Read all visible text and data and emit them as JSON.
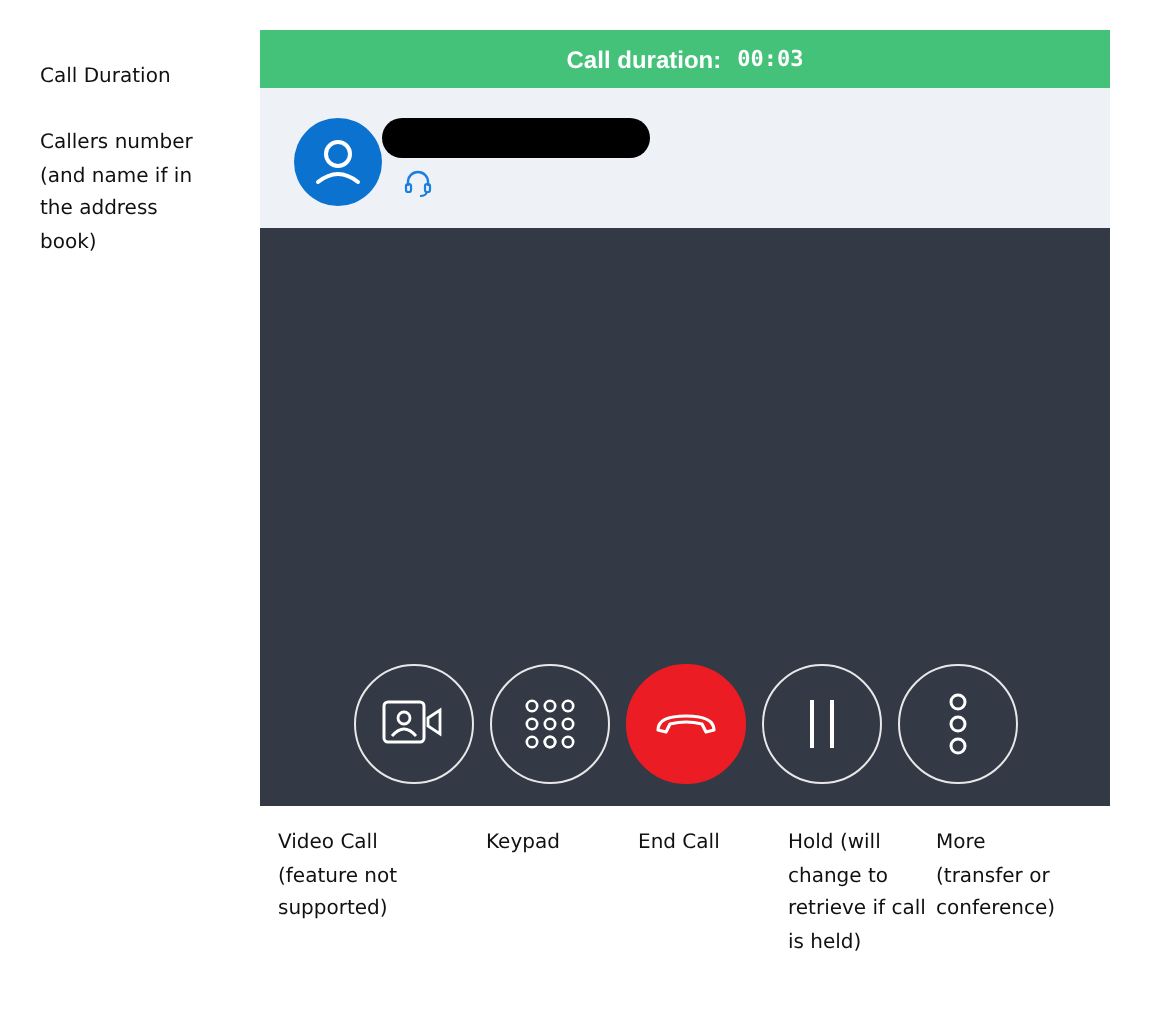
{
  "annotations": [
    "Call Duration",
    "Callers number (and name if in the address book)"
  ],
  "call_bar": {
    "label": "Call duration:",
    "duration": "00:03"
  },
  "caller": {
    "number_redacted": true
  },
  "controls": [
    {
      "kind": "video",
      "caption": "Video Call (feature not supported)"
    },
    {
      "kind": "keypad",
      "caption": "Keypad"
    },
    {
      "kind": "end",
      "caption": "End Call"
    },
    {
      "kind": "hold",
      "caption": "Hold (will change to retrieve if call is held)"
    },
    {
      "kind": "more",
      "caption": "More (transfer or conference)"
    }
  ]
}
